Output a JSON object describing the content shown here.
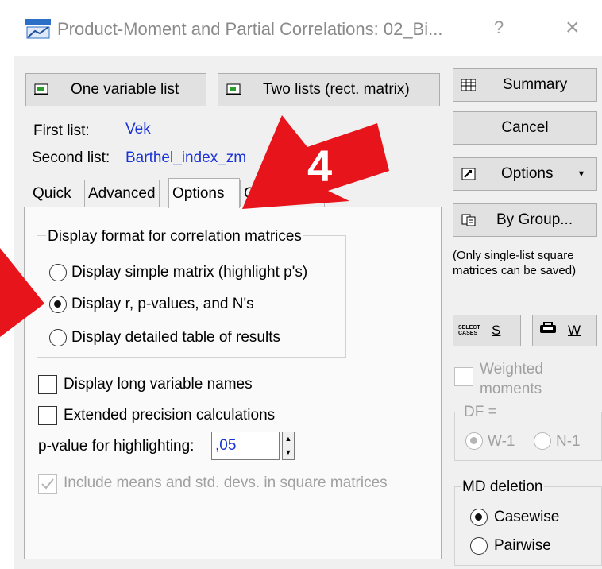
{
  "window": {
    "title": "Product-Moment and Partial Correlations: 02_Bi...",
    "help_glyph": "?",
    "close_glyph": "×"
  },
  "top_buttons": {
    "one_list": "One variable list",
    "two_lists": "Two lists (rect. matrix)"
  },
  "lists": {
    "first_label": "First list:",
    "first_value": "Vek",
    "second_label": "Second list:",
    "second_value": "Barthel_index_zm"
  },
  "tabs": [
    "Quick",
    "Advanced",
    "Options",
    "Color maps"
  ],
  "active_tab": "Options",
  "options": {
    "group_title": "Display format for correlation matrices",
    "radios": [
      {
        "label": "Display simple matrix (highlight p's)",
        "selected": false
      },
      {
        "label": "Display r, p-values, and N's",
        "selected": true
      },
      {
        "label": "Display detailed table of results",
        "selected": false
      }
    ],
    "long_names_label": "Display long variable names",
    "extended_label": "Extended precision calculations",
    "pvalue_label": "p-value for highlighting:",
    "pvalue_value": ",05",
    "include_means_label": "Include means and std. devs. in square matrices"
  },
  "right_buttons": {
    "summary": "Summary",
    "cancel": "Cancel",
    "options": "Options",
    "by_group": "By Group...",
    "note": "(Only single-list square matrices can be saved)",
    "select_cases_icon_text": "SELECT CASES",
    "s_label": "S",
    "w_label": "W"
  },
  "weighted": {
    "label": "Weighted moments",
    "df_label": "DF =",
    "w1": "W-1",
    "n1": "N-1"
  },
  "md_deletion": {
    "title": "MD deletion",
    "casewise": "Casewise",
    "pairwise": "Pairwise",
    "selected": "Casewise"
  },
  "annotation": {
    "step_number": "4",
    "color": "#e8141b"
  }
}
